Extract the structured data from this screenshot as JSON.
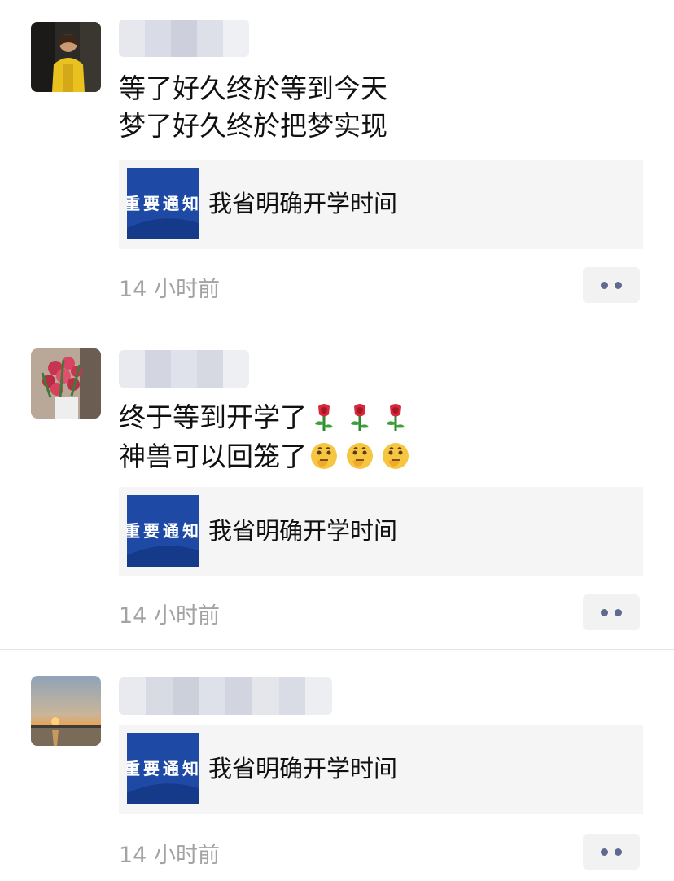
{
  "posts": [
    {
      "lines": [
        "等了好久终於等到今天",
        "梦了好久终於把梦实现"
      ],
      "link": {
        "thumb_text": "重要通知",
        "title": "我省明确开学时间"
      },
      "time": "14 小时前"
    },
    {
      "line1": "终于等到开学了",
      "line2": "神兽可以回笼了",
      "link": {
        "thumb_text": "重要通知",
        "title": "我省明确开学时间"
      },
      "time": "14 小时前"
    },
    {
      "link": {
        "thumb_text": "重要通知",
        "title": "我省明确开学时间"
      },
      "time": "14 小时前"
    }
  ],
  "icons": {
    "rose": "rose-emoji",
    "thinking": "thinking-face-emoji",
    "more": "more-dots-icon"
  },
  "colors": {
    "more_dots": "#5e6b8f",
    "thumb_blue": "#1e4aa6",
    "card_bg": "#f5f5f5",
    "timestamp": "#a3a3a3"
  }
}
